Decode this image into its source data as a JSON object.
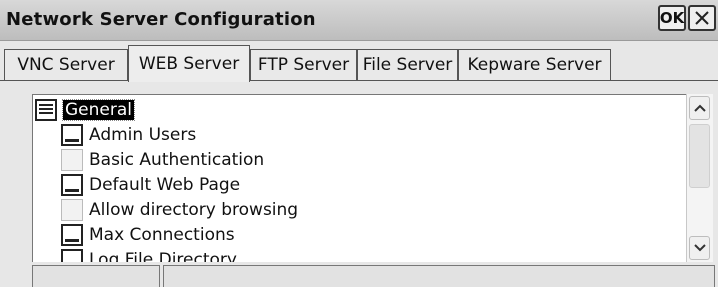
{
  "window": {
    "title": "Network Server Configuration",
    "ok_label": "OK",
    "close_icon": "close-icon"
  },
  "tabs": [
    {
      "label": "VNC Server",
      "active": false
    },
    {
      "label": "WEB Server",
      "active": true
    },
    {
      "label": "FTP Server",
      "active": false
    },
    {
      "label": "File Server",
      "active": false
    },
    {
      "label": "Kepware Server",
      "active": false
    }
  ],
  "tree": {
    "items": [
      {
        "label": "General",
        "icon": "list-icon",
        "selected": true
      },
      {
        "label": "Admin Users",
        "icon": "doc-icon"
      },
      {
        "label": "Basic Authentication",
        "icon": "blank-icon"
      },
      {
        "label": "Default Web Page",
        "icon": "doc-icon"
      },
      {
        "label": "Allow directory browsing",
        "icon": "blank-icon"
      },
      {
        "label": "Max Connections",
        "icon": "doc-icon"
      },
      {
        "label": "Log File Directory",
        "icon": "doc-icon"
      }
    ]
  },
  "scrollbar": {
    "up_icon": "chevron-up-icon",
    "down_icon": "chevron-down-icon"
  },
  "colors": {
    "selection_bg": "#000000",
    "selection_fg": "#ffffff"
  }
}
